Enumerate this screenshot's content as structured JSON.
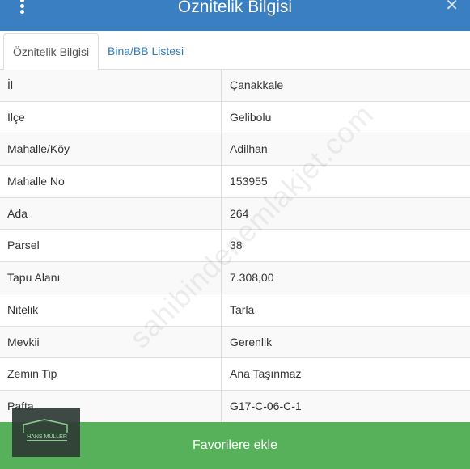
{
  "header": {
    "title": "Öznitelik Bilgisi",
    "menu_icon": "more-vertical-icon",
    "close_icon": "close-icon",
    "color": "#3a7fc1"
  },
  "tabs": [
    {
      "label": "Öznitelik Bilgisi",
      "active": true
    },
    {
      "label": "Bina/BB Listesi",
      "active": false
    }
  ],
  "attributes": [
    {
      "label": "İl",
      "value": "Çanakkale"
    },
    {
      "label": "İlçe",
      "value": "Gelibolu"
    },
    {
      "label": "Mahalle/Köy",
      "value": "Adilhan"
    },
    {
      "label": "Mahalle No",
      "value": "153955"
    },
    {
      "label": "Ada",
      "value": "264"
    },
    {
      "label": "Parsel",
      "value": "38"
    },
    {
      "label": "Tapu Alanı",
      "value": "7.308,00"
    },
    {
      "label": "Nitelik",
      "value": "Tarla"
    },
    {
      "label": "Mevkii",
      "value": "Gerenlik"
    },
    {
      "label": "Zemin Tip",
      "value": "Ana Taşınmaz"
    },
    {
      "label": "Pafta",
      "value": "G17-C-06-C-1"
    }
  ],
  "footer": {
    "button_label": "Favorilere ekle",
    "color": "#57b05a"
  },
  "watermark": {
    "text": "sahibindenemlakjet.com"
  },
  "logo": {
    "text": "HANS MÜLLER"
  }
}
